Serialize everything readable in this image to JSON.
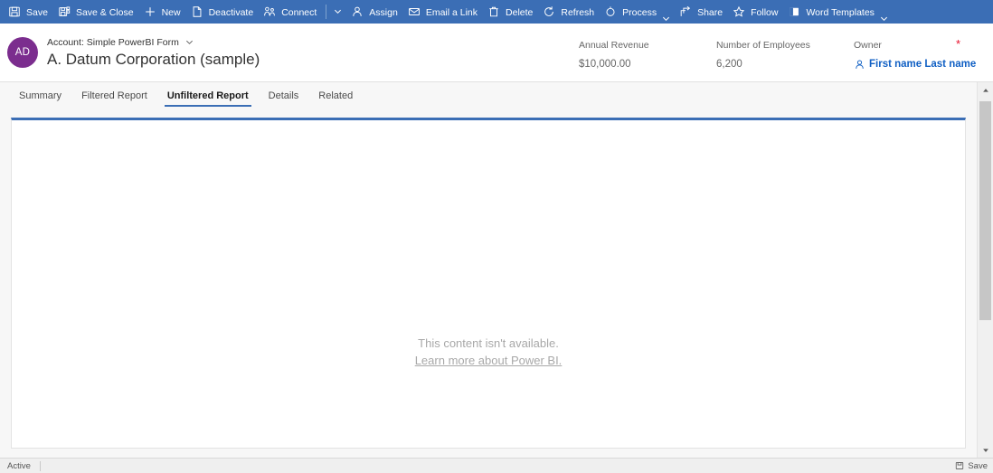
{
  "commandbar": {
    "accent_color": "#3b6eb5",
    "items": [
      {
        "label": "Save",
        "icon": "save-icon",
        "chevron": false
      },
      {
        "label": "Save & Close",
        "icon": "save-and-close-icon",
        "chevron": false
      },
      {
        "label": "New",
        "icon": "plus-icon",
        "chevron": false
      },
      {
        "label": "Deactivate",
        "icon": "page-icon",
        "chevron": false
      },
      {
        "label": "Connect",
        "icon": "connect-people-icon",
        "chevron": false,
        "separator_after": true,
        "split_chevron": true
      },
      {
        "label": "Assign",
        "icon": "person-icon",
        "chevron": false
      },
      {
        "label": "Email a Link",
        "icon": "email-link-icon",
        "chevron": false
      },
      {
        "label": "Delete",
        "icon": "trash-icon",
        "chevron": false
      },
      {
        "label": "Refresh",
        "icon": "refresh-icon",
        "chevron": false
      },
      {
        "label": "Process",
        "icon": "process-icon",
        "chevron": true
      },
      {
        "label": "Share",
        "icon": "share-icon",
        "chevron": false
      },
      {
        "label": "Follow",
        "icon": "star-icon",
        "chevron": false
      },
      {
        "label": "Word Templates",
        "icon": "word-templates-icon",
        "chevron": true
      }
    ]
  },
  "record_header": {
    "avatar_initials": "AD",
    "avatar_color": "#7b2d8e",
    "form_selector": "Account: Simple PowerBI Form",
    "title": "A. Datum Corporation (sample)",
    "fields": [
      {
        "label": "Annual Revenue",
        "value": "$10,000.00",
        "required": false
      },
      {
        "label": "Number of Employees",
        "value": "6,200",
        "required": false
      }
    ],
    "owner": {
      "label": "Owner",
      "value": "First name Last name",
      "required": true,
      "required_marker": "*",
      "required_color": "#e8112d",
      "link_color": "#1160c4",
      "icon": "person-icon"
    }
  },
  "tabs": [
    {
      "label": "Summary",
      "active": false
    },
    {
      "label": "Filtered Report",
      "active": false
    },
    {
      "label": "Unfiltered Report",
      "active": true
    },
    {
      "label": "Details",
      "active": false
    },
    {
      "label": "Related",
      "active": false
    }
  ],
  "powerbi_panel": {
    "empty_message": "This content isn't available.",
    "learn_more_link": "Learn more about Power BI.",
    "top_border_color": "#3b6eb5"
  },
  "statusbar": {
    "state": "Active",
    "save_label": "Save",
    "save_icon": "save-icon"
  }
}
